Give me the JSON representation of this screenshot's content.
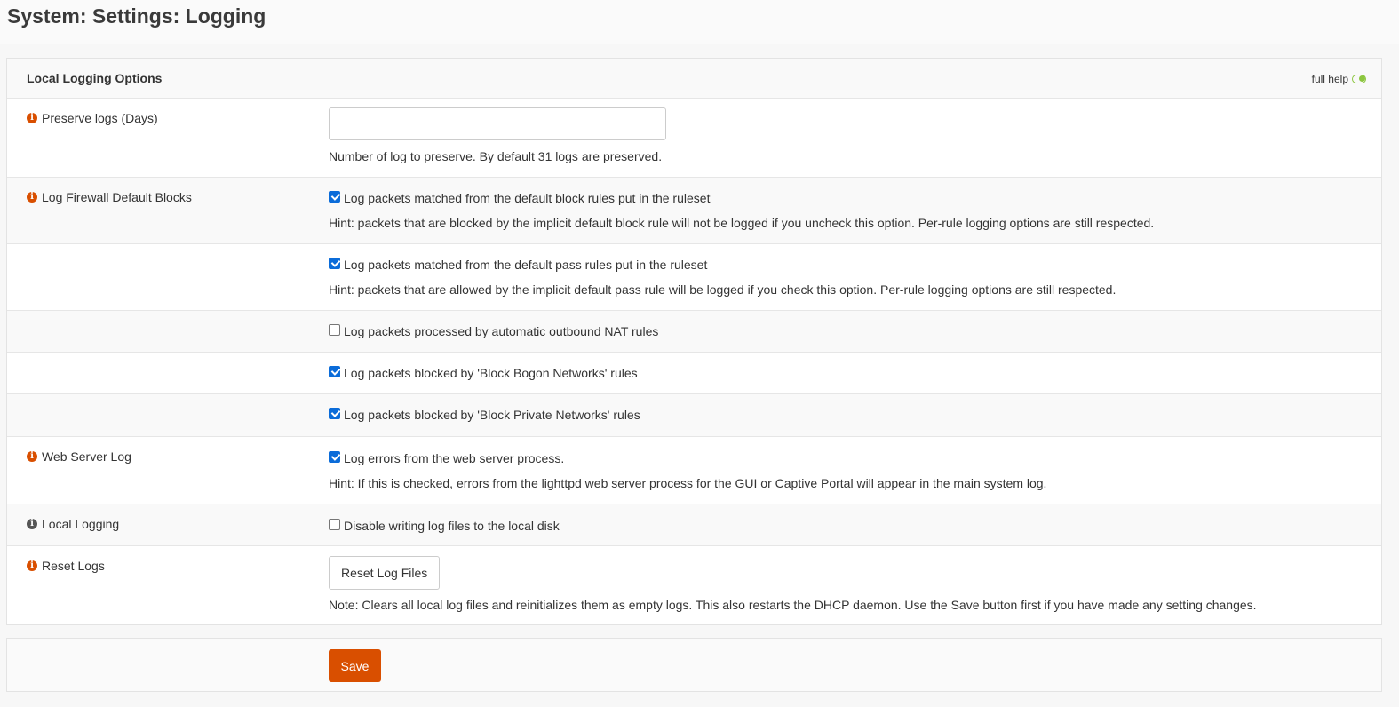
{
  "page": {
    "title": "System: Settings: Logging"
  },
  "section": {
    "title": "Local Logging Options",
    "full_help": "full help"
  },
  "preserve": {
    "label": "Preserve logs (Days)",
    "value": "",
    "hint": "Number of log to preserve. By default 31 logs are preserved."
  },
  "firewall": {
    "label": "Log Firewall Default Blocks",
    "items": [
      {
        "label": "Log packets matched from the default block rules put in the ruleset",
        "checked": true,
        "hint": "Hint: packets that are blocked by the implicit default block rule will not be logged if you uncheck this option. Per-rule logging options are still respected."
      },
      {
        "label": "Log packets matched from the default pass rules put in the ruleset",
        "checked": true,
        "hint": "Hint: packets that are allowed by the implicit default pass rule will be logged if you check this option. Per-rule logging options are still respected."
      },
      {
        "label": "Log packets processed by automatic outbound NAT rules",
        "checked": false
      },
      {
        "label": "Log packets blocked by 'Block Bogon Networks' rules",
        "checked": true
      },
      {
        "label": "Log packets blocked by 'Block Private Networks' rules",
        "checked": true
      }
    ]
  },
  "webserver": {
    "label": "Web Server Log",
    "cb_label": "Log errors from the web server process.",
    "checked": true,
    "hint": "Hint: If this is checked, errors from the lighttpd web server process for the GUI or Captive Portal will appear in the main system log."
  },
  "local_logging": {
    "label": "Local Logging",
    "cb_label": "Disable writing log files to the local disk",
    "checked": false
  },
  "reset": {
    "label": "Reset Logs",
    "button": "Reset Log Files",
    "note": "Note: Clears all local log files and reinitializes them as empty logs. This also restarts the DHCP daemon. Use the Save button first if you have made any setting changes."
  },
  "save": {
    "label": "Save"
  },
  "colors": {
    "accent": "#d94f00",
    "checkbox": "#0b6cd9",
    "toggle": "#8cc63f"
  },
  "icons": {
    "info": "info-circle-icon",
    "toggle": "toggle-on-icon"
  }
}
